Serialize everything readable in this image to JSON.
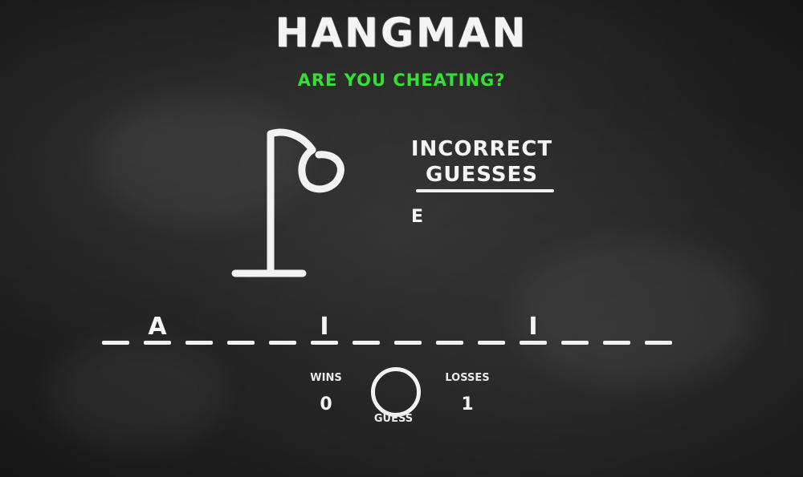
{
  "game": {
    "title": "HANGMAN",
    "subtitle": "ARE YOU CHEATING?",
    "accent_color": "#33e133"
  },
  "incorrect": {
    "heading_line1": "INCORRECT",
    "heading_line2": "GUESSES",
    "letters": "E"
  },
  "word": {
    "slots": [
      "",
      "A",
      "",
      "",
      "",
      "I",
      "",
      "",
      "",
      "",
      "I",
      "",
      "",
      "",
      ""
    ]
  },
  "stats": {
    "wins_label": "WINS",
    "wins_value": "0",
    "losses_label": "LOSSES",
    "losses_value": "1",
    "guess_label": "GUESS"
  }
}
